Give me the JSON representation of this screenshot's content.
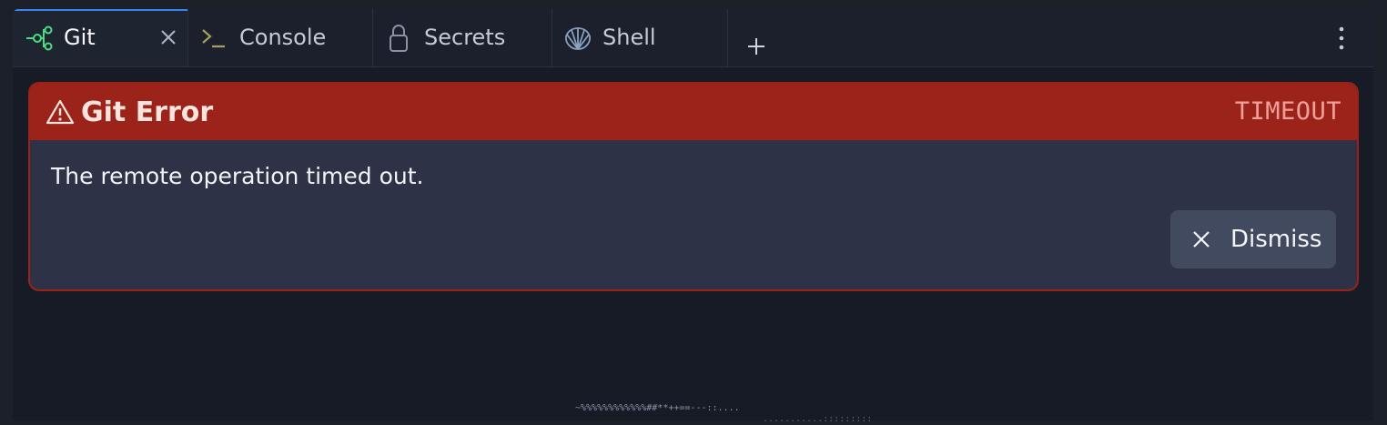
{
  "tabs": [
    {
      "label": "Git",
      "icon": "git-branch-icon",
      "active": true
    },
    {
      "label": "Console",
      "icon": "terminal-icon",
      "active": false
    },
    {
      "label": "Secrets",
      "icon": "lock-icon",
      "active": false
    },
    {
      "label": "Shell",
      "icon": "shell-icon",
      "active": false
    }
  ],
  "tabbar": {
    "close_icon": "close-icon",
    "new_tab_icon": "plus-icon",
    "more_icon": "kebab-icon"
  },
  "error_card": {
    "title": "Git Error",
    "code": "TIMEOUT",
    "message": "The remote operation timed out.",
    "dismiss_label": "Dismiss",
    "icon": "warning-icon",
    "colors": {
      "header": "#9b2319",
      "body": "#2d3246",
      "code": "#f0a09a"
    }
  },
  "ascii_art": {
    "line1": "~%%%%%%%%%%%%##**++==---::....",
    "line2": "...........:::::::::"
  },
  "colors": {
    "accent": "#3b82f6",
    "git_icon": "#4ade80",
    "console_icon": "#a3a05a"
  }
}
